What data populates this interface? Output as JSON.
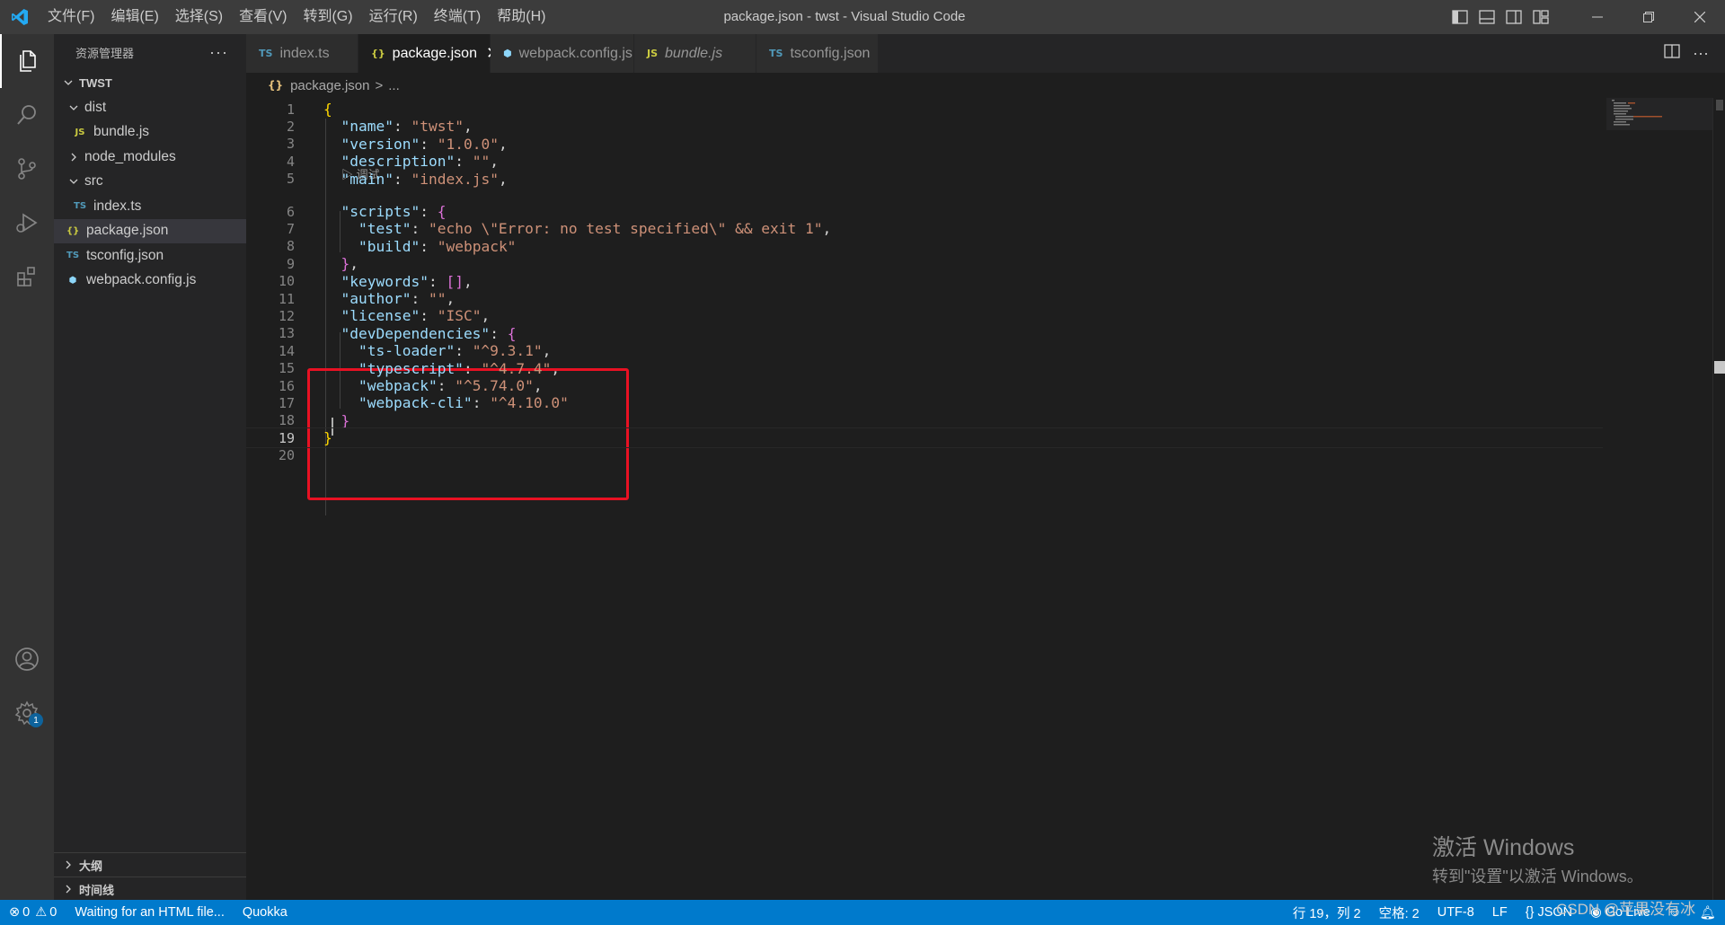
{
  "window": {
    "title": "package.json - twst - Visual Studio Code",
    "menu": [
      "文件(F)",
      "编辑(E)",
      "选择(S)",
      "查看(V)",
      "转到(G)",
      "运行(R)",
      "终端(T)",
      "帮助(H)"
    ]
  },
  "sidebar": {
    "title": "资源管理器",
    "more": "···",
    "root": "TWST",
    "items": [
      {
        "label": "dist",
        "kind": "folder-open",
        "indent": 1
      },
      {
        "label": "bundle.js",
        "kind": "js",
        "icon": "JS",
        "indent": 2
      },
      {
        "label": "node_modules",
        "kind": "folder-closed",
        "indent": 1
      },
      {
        "label": "src",
        "kind": "folder-open",
        "indent": 1
      },
      {
        "label": "index.ts",
        "kind": "ts",
        "icon": "TS",
        "indent": 2
      },
      {
        "label": "package.json",
        "kind": "json",
        "icon": "{}",
        "indent": 1,
        "selected": true
      },
      {
        "label": "tsconfig.json",
        "kind": "tsconfig",
        "icon": "TS",
        "indent": 1
      },
      {
        "label": "webpack.config.js",
        "kind": "webpack",
        "icon": "⬢",
        "indent": 1
      }
    ],
    "outline": "大纲",
    "timeline": "时间线"
  },
  "tabs": [
    {
      "label": "index.ts",
      "icon": "TS",
      "active": false
    },
    {
      "label": "package.json",
      "icon": "{}",
      "active": true,
      "close": "✕"
    },
    {
      "label": "webpack.config.js",
      "icon": "⬢",
      "active": false
    },
    {
      "label": "bundle.js",
      "icon": "JS",
      "active": false
    },
    {
      "label": "tsconfig.json",
      "icon": "TS",
      "active": false
    }
  ],
  "breadcrumb": {
    "icon": "{}",
    "file": "package.json",
    "sep": ">",
    "rest": "..."
  },
  "codelens": "▷ 调试",
  "code_lines": [
    "{",
    "  \"name\": \"twst\",",
    "  \"version\": \"1.0.0\",",
    "  \"description\": \"\",",
    "  \"main\": \"index.js\",",
    "  \"scripts\": {",
    "    \"test\": \"echo \\\"Error: no test specified\\\" && exit 1\",",
    "    \"build\": \"webpack\"",
    "  },",
    "  \"keywords\": [],",
    "  \"author\": \"\",",
    "  \"license\": \"ISC\",",
    "  \"devDependencies\": {",
    "    \"ts-loader\": \"^9.3.1\",",
    "    \"typescript\": \"^4.7.4\",",
    "    \"webpack\": \"^5.74.0\",",
    "    \"webpack-cli\": \"^4.10.0\"",
    "  }",
    "}",
    ""
  ],
  "watermark": {
    "line1": "激活 Windows",
    "line2": "转到\"设置\"以激活 Windows。",
    "credit": "CSDN @苹果没有冰"
  },
  "statusbar": {
    "errors": "0",
    "warnings": "0",
    "message": "Waiting for an HTML file...",
    "quokka": "Quokka",
    "position": "行 19，列 2",
    "spaces": "空格: 2",
    "encoding": "UTF-8",
    "eol": "LF",
    "language": "{} JSON",
    "golive": "Go Live"
  },
  "colors": {
    "accent": "#007acc",
    "highlight_box": "#e81123",
    "key": "#9cdcfe",
    "string": "#ce9178"
  }
}
